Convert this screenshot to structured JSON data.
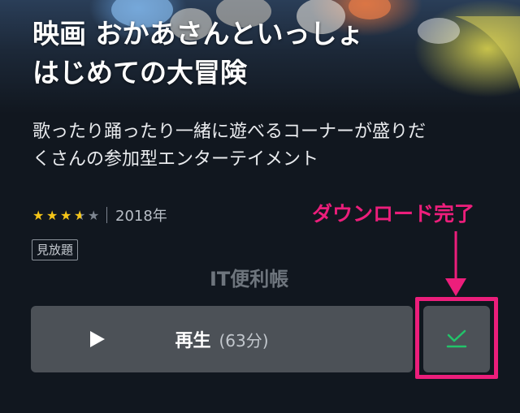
{
  "hero": {
    "title_lines": [
      "映画 おかあさんといっしょ",
      "はじめての大冒険"
    ]
  },
  "description_lines": [
    "歌ったり踊ったり一緒に遊べるコーナーが盛りだ",
    "くさんの参加型エンターテイメント"
  ],
  "rating": {
    "stars": 3.5,
    "max": 5,
    "year": "2018年"
  },
  "badge": "見放題",
  "watermark": "IT便利帳",
  "annotation": {
    "label": "ダウンロード完了",
    "color": "#ec1e7b"
  },
  "play_button": {
    "icon": "play-icon",
    "label": "再生",
    "duration": "(63分)"
  },
  "download_button": {
    "icon": "download-complete-check-icon",
    "state": "downloaded",
    "accent": "#22c46a"
  },
  "colors": {
    "background": "#11171f",
    "button": "#4c5157",
    "star": "#f5c518"
  }
}
